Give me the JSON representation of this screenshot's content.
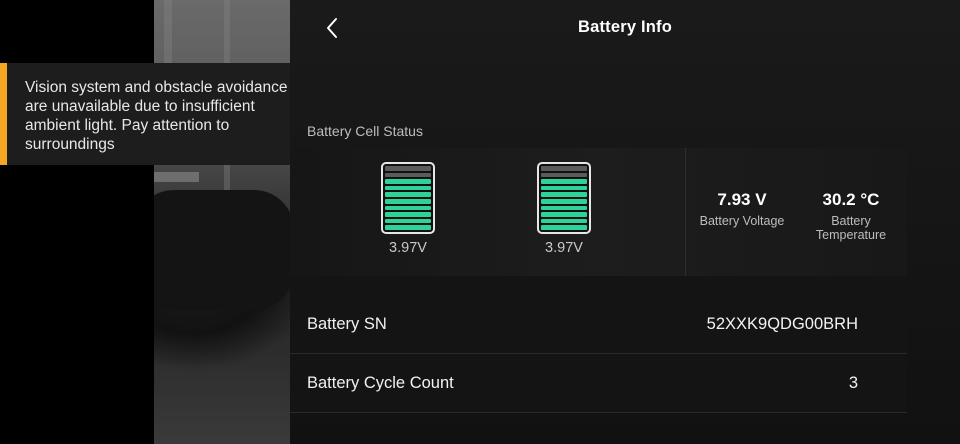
{
  "toast": {
    "message": "Vision system and obstacle avoidance are unavailable due to insufficient ambient light. Pay attention to surroundings",
    "accent_color": "#f5a623"
  },
  "header": {
    "title": "Battery Info",
    "back_icon": "chevron-left-icon"
  },
  "cells_section": {
    "label": "Battery Cell Status",
    "cells": [
      {
        "voltage": "3.97V",
        "level": 0.83
      },
      {
        "voltage": "3.97V",
        "level": 0.83
      }
    ],
    "fill_color": "#2ed39a"
  },
  "metrics": {
    "voltage": {
      "value": "7.93 V",
      "label": "Battery Voltage"
    },
    "temperature": {
      "value": "30.2 °C",
      "label": "Battery Temperature"
    }
  },
  "rows": {
    "sn": {
      "label": "Battery SN",
      "value": "52XXK9QDG00BRH"
    },
    "cycle": {
      "label": "Battery Cycle Count",
      "value": "3"
    }
  }
}
